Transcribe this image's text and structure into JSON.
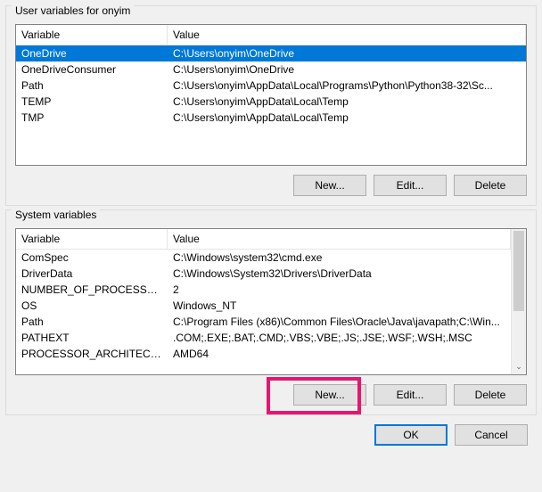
{
  "userGroup": {
    "label": "User variables for onyim",
    "headers": {
      "variable": "Variable",
      "value": "Value"
    },
    "rows": [
      {
        "variable": "OneDrive",
        "value": "C:\\Users\\onyim\\OneDrive",
        "selected": true
      },
      {
        "variable": "OneDriveConsumer",
        "value": "C:\\Users\\onyim\\OneDrive",
        "selected": false
      },
      {
        "variable": "Path",
        "value": "C:\\Users\\onyim\\AppData\\Local\\Programs\\Python\\Python38-32\\Sc...",
        "selected": false
      },
      {
        "variable": "TEMP",
        "value": "C:\\Users\\onyim\\AppData\\Local\\Temp",
        "selected": false
      },
      {
        "variable": "TMP",
        "value": "C:\\Users\\onyim\\AppData\\Local\\Temp",
        "selected": false
      }
    ],
    "buttons": {
      "new": "New...",
      "edit": "Edit...",
      "delete": "Delete"
    }
  },
  "systemGroup": {
    "label": "System variables",
    "headers": {
      "variable": "Variable",
      "value": "Value"
    },
    "rows": [
      {
        "variable": "ComSpec",
        "value": "C:\\Windows\\system32\\cmd.exe"
      },
      {
        "variable": "DriverData",
        "value": "C:\\Windows\\System32\\Drivers\\DriverData"
      },
      {
        "variable": "NUMBER_OF_PROCESSORS",
        "value": "2"
      },
      {
        "variable": "OS",
        "value": "Windows_NT"
      },
      {
        "variable": "Path",
        "value": "C:\\Program Files (x86)\\Common Files\\Oracle\\Java\\javapath;C:\\Win..."
      },
      {
        "variable": "PATHEXT",
        "value": ".COM;.EXE;.BAT;.CMD;.VBS;.VBE;.JS;.JSE;.WSF;.WSH;.MSC"
      },
      {
        "variable": "PROCESSOR_ARCHITECTURE",
        "value": "AMD64"
      }
    ],
    "buttons": {
      "new": "New...",
      "edit": "Edit...",
      "delete": "Delete"
    }
  },
  "footer": {
    "ok": "OK",
    "cancel": "Cancel"
  },
  "scrollArrow": "⌄"
}
